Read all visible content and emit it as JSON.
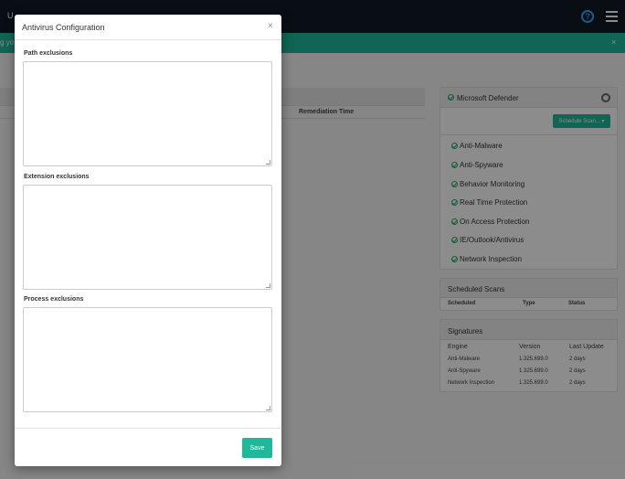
{
  "topbar": {
    "title": "U"
  },
  "alert": {
    "text": "g yo",
    "close": "×"
  },
  "left_panel": {
    "column_header": "Remediation Time"
  },
  "defender": {
    "title": "Microsoft Defender",
    "schedule_button": "Schedule Scan... ▾",
    "features": [
      "Anti-Malware",
      "Anti-Spyware",
      "Behavior Monitoring",
      "Real Time Protection",
      "On Access Protection",
      "IE/Outlook/Antivirus",
      "Network Inspection"
    ]
  },
  "scheduled_scans": {
    "title": "Scheduled Scans",
    "columns": [
      "Scheduled",
      "Type",
      "Status"
    ]
  },
  "signatures": {
    "title": "Signatures",
    "columns": [
      "Engine",
      "Version",
      "Last Update"
    ],
    "rows": [
      [
        "Anti-Malware",
        "1.325.699.0",
        "2 days"
      ],
      [
        "Anti-Spyware",
        "1.325.699.0",
        "2 days"
      ],
      [
        "Network Inspection",
        "1.325.699.0",
        "2 days"
      ]
    ]
  },
  "modal": {
    "title": "Antivirus Configuration",
    "close": "×",
    "path_label": "Path exclusions",
    "extension_label": "Extension exclusions",
    "process_label": "Process exclusions",
    "path_value": "",
    "extension_value": "",
    "process_value": "",
    "save_label": "Save"
  },
  "colors": {
    "accent": "#1fb89a",
    "topbar": "#0f1b26",
    "help": "#3aa3ff"
  }
}
